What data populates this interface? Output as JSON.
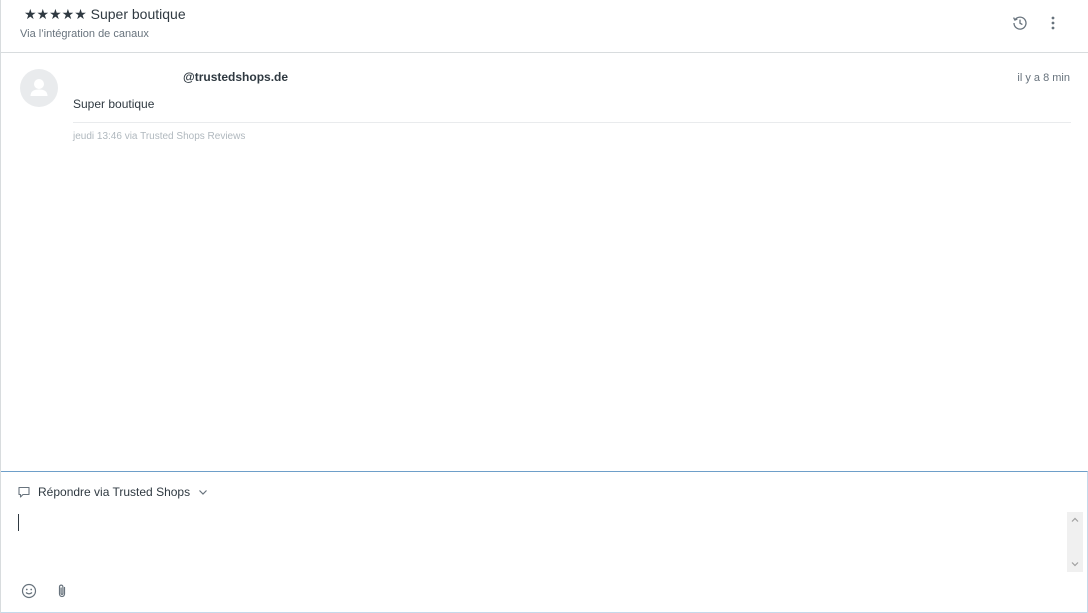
{
  "header": {
    "title": "★★★★★ Super boutique",
    "subtitle": "Via l’intégration de canaux",
    "history_icon": "history-icon",
    "more_icon": "more-vertical-icon"
  },
  "message": {
    "avatar_icon": "user-icon",
    "sender": "@trustedshops.de",
    "time": "il y a 8 min",
    "body": "Super boutique",
    "meta": "jeudi 13:46 via Trusted Shops Reviews"
  },
  "composer": {
    "channel_label": "Répondre via Trusted Shops",
    "channel_icon": "speech-bubble-icon",
    "chevron_icon": "chevron-down-icon",
    "reply_value": "",
    "emoji_icon": "emoji-icon",
    "attach_icon": "paperclip-icon"
  },
  "colors": {
    "accent_border": "#6e9fc9",
    "text": "#2f3941",
    "muted": "#68737d"
  }
}
